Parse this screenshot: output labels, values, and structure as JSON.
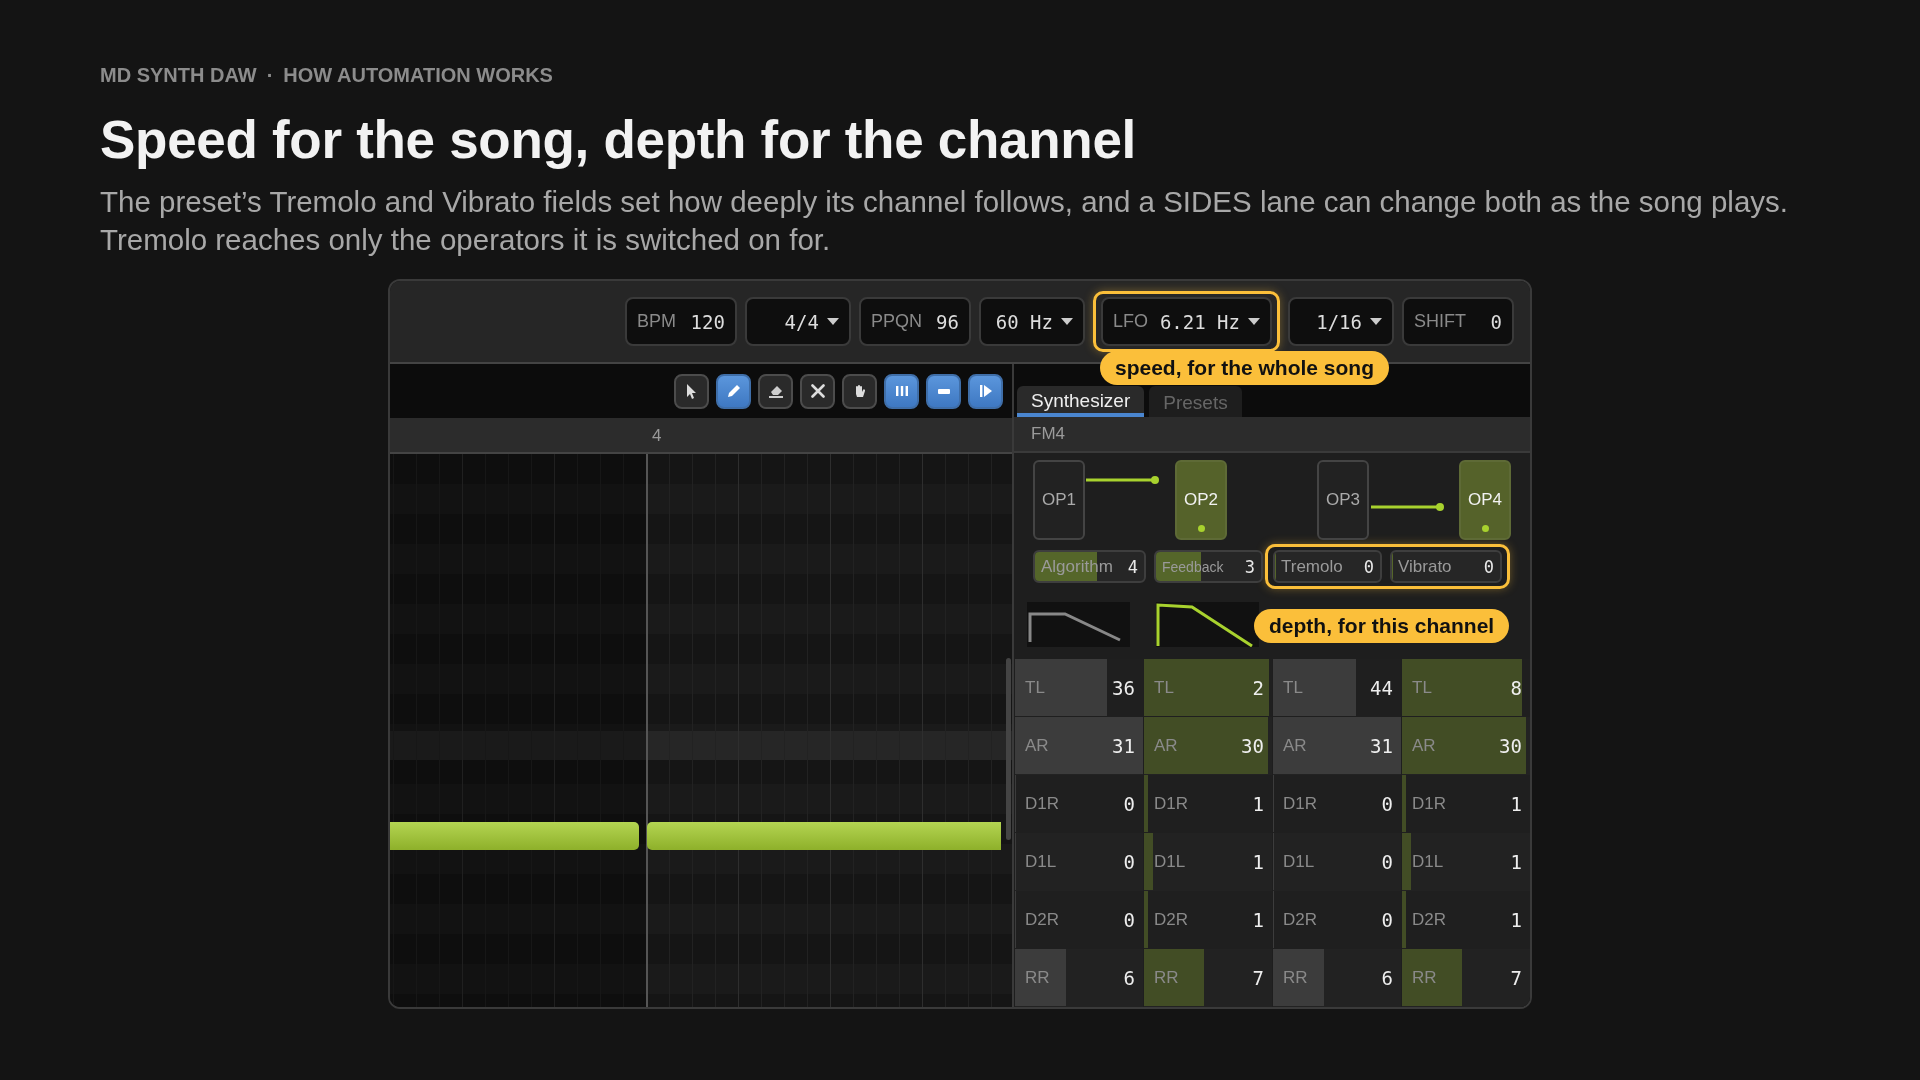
{
  "breadcrumb": {
    "items": [
      "MD SYNTH DAW",
      "HOW AUTOMATION WORKS"
    ],
    "separator": "·"
  },
  "title": "Speed for the song, depth for the channel",
  "description": [
    "The preset’s Tremolo and Vibrato fields set how deeply its channel follows, and a SIDES lane can change both as the song plays.",
    "Tremolo reaches only the operators it is switched on for."
  ],
  "toolbar": {
    "fields": [
      {
        "kind": "value",
        "label": "BPM",
        "value": "120",
        "highlighted": false
      },
      {
        "kind": "dropdown",
        "value": "4/4",
        "highlighted": false
      },
      {
        "kind": "value",
        "label": "PPQN",
        "value": "96",
        "highlighted": false
      },
      {
        "kind": "dropdown",
        "value": "60 Hz",
        "highlighted": false
      },
      {
        "kind": "dropdown",
        "label": "LFO",
        "value": "6.21 Hz",
        "highlighted": true
      },
      {
        "kind": "dropdown",
        "value": "1/16",
        "highlighted": false
      },
      {
        "kind": "value",
        "label": "SHIFT",
        "value": "0",
        "highlighted": false
      }
    ],
    "callout": "speed, for the whole song"
  },
  "editor": {
    "tools": [
      {
        "active": false
      },
      {
        "active": true
      },
      {
        "active": false
      },
      {
        "active": false
      },
      {
        "active": false
      },
      {
        "active": true
      },
      {
        "active": true
      },
      {
        "active": true
      }
    ],
    "ruler_label": "4"
  },
  "synth": {
    "tabs": [
      {
        "label": "Synthesizer",
        "selected": true
      },
      {
        "label": "Presets",
        "selected": false
      }
    ],
    "header": "FM4",
    "operators": [
      {
        "label": "OP1",
        "carrier": false
      },
      {
        "label": "OP2",
        "carrier": true
      },
      {
        "label": "OP3",
        "carrier": false
      },
      {
        "label": "OP4",
        "carrier": true
      }
    ],
    "params": [
      {
        "label": "Algorithm",
        "value": "4",
        "level": 0.57,
        "highlighted": false
      },
      {
        "label": "Feedback",
        "value": "3",
        "level": 0.43,
        "highlighted": false
      },
      {
        "label": "Tremolo",
        "value": "0",
        "level": 0,
        "highlighted": true
      },
      {
        "label": "Vibrato",
        "value": "0",
        "level": 0,
        "highlighted": true
      }
    ],
    "callout": "depth, for this channel",
    "rows": [
      {
        "cells": [
          {
            "label": "TL",
            "value": "36",
            "level": 0.72
          },
          {
            "label": "TL",
            "value": "2",
            "level": 0.98
          },
          {
            "label": "TL",
            "value": "44",
            "level": 0.65
          },
          {
            "label": "TL",
            "value": "8",
            "level": 0.94
          }
        ]
      },
      {
        "cells": [
          {
            "label": "AR",
            "value": "31",
            "level": 1
          },
          {
            "label": "AR",
            "value": "30",
            "level": 0.97
          },
          {
            "label": "AR",
            "value": "31",
            "level": 1
          },
          {
            "label": "AR",
            "value": "30",
            "level": 0.97
          }
        ]
      },
      {
        "cells": [
          {
            "label": "D1R",
            "value": "0",
            "level": 0
          },
          {
            "label": "D1R",
            "value": "1",
            "level": 0.03
          },
          {
            "label": "D1R",
            "value": "0",
            "level": 0
          },
          {
            "label": "D1R",
            "value": "1",
            "level": 0.03
          }
        ]
      },
      {
        "cells": [
          {
            "label": "D1L",
            "value": "0",
            "level": 0
          },
          {
            "label": "D1L",
            "value": "1",
            "level": 0.07
          },
          {
            "label": "D1L",
            "value": "0",
            "level": 0
          },
          {
            "label": "D1L",
            "value": "1",
            "level": 0.07
          }
        ]
      },
      {
        "cells": [
          {
            "label": "D2R",
            "value": "0",
            "level": 0
          },
          {
            "label": "D2R",
            "value": "1",
            "level": 0.03
          },
          {
            "label": "D2R",
            "value": "0",
            "level": 0
          },
          {
            "label": "D2R",
            "value": "1",
            "level": 0.03
          }
        ]
      },
      {
        "cells": [
          {
            "label": "RR",
            "value": "6",
            "level": 0.4
          },
          {
            "label": "RR",
            "value": "7",
            "level": 0.47
          },
          {
            "label": "RR",
            "value": "6",
            "level": 0.4
          },
          {
            "label": "RR",
            "value": "7",
            "level": 0.47
          }
        ]
      }
    ]
  }
}
